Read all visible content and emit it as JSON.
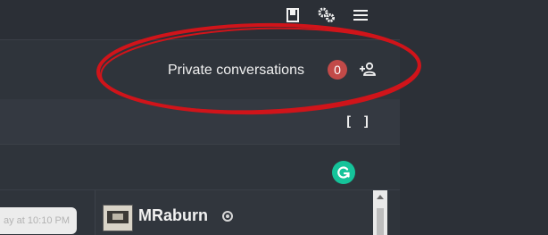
{
  "topbar": {
    "icons": [
      "bookmark-icon",
      "settings-icon",
      "menu-icon"
    ]
  },
  "private_conversations": {
    "label": "Private conversations",
    "count": "0",
    "add_icon": "add-user-icon"
  },
  "toolbar": {
    "brackets_label": "[ ]"
  },
  "grammarly": {
    "icon": "grammarly-icon",
    "color": "#15c39a"
  },
  "message": {
    "time": "ay at 10:10 PM"
  },
  "user": {
    "name": "MRaburn",
    "status_icon": "status-icon"
  },
  "colors": {
    "badge": "#c24a48",
    "annotation": "#d0141a",
    "background": "#2f343b"
  }
}
